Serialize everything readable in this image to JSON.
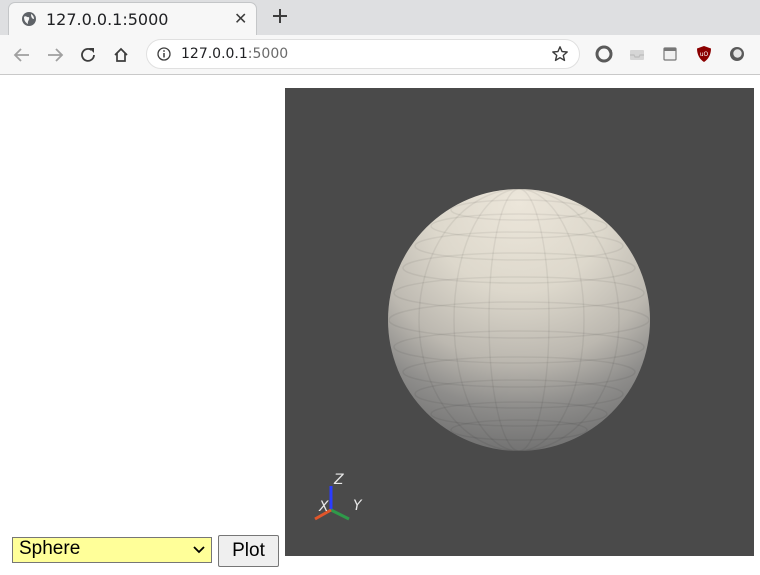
{
  "browser": {
    "tab_title": "127.0.0.1:5000",
    "url_host": "127.0.0.1",
    "url_port": ":5000"
  },
  "icons": {
    "tab": "globe-icon",
    "close": "close-icon",
    "new_tab": "plus-icon",
    "back": "back-arrow-icon",
    "forward": "forward-arrow-icon",
    "reload": "reload-icon",
    "home": "home-icon",
    "info": "info-icon",
    "bookmark": "star-icon",
    "extensions": [
      "circle-arrow-icon",
      "inbox-icon",
      "window-icon",
      "ublock-icon",
      "round-icon"
    ]
  },
  "scene": {
    "background": "#4a4a4a",
    "object": "sphere",
    "sphere_color": "#e8e2d6",
    "axes": {
      "z_label": "Z",
      "x_label": "X",
      "y_label": "Y",
      "z_color": "#2a3cff",
      "x_color": "#e0562a",
      "y_color": "#2f9a4a"
    }
  },
  "controls": {
    "shape_select_value": "Sphere",
    "select_background": "#ffff99",
    "plot_label": "Plot"
  }
}
